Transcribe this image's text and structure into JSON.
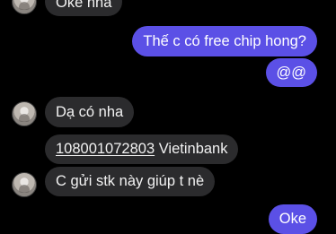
{
  "messages": {
    "m1": "Oke nha",
    "m2": "Thế c có free chip hong?",
    "m3": "@@",
    "m4": "Dạ có nha",
    "m5_account": "108001072803",
    "m5_bank": "Vietinbank",
    "m6": "C gửi stk này giúp t nè",
    "m7": "Oke"
  },
  "colors": {
    "background": "#000000",
    "incoming_bubble": "#2b2b2d",
    "outgoing_bubble": "#5b50e6"
  }
}
